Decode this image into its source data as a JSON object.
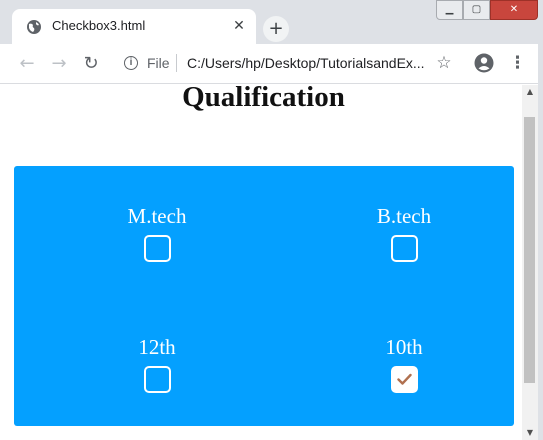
{
  "browser": {
    "tab_title": "Checkbox3.html",
    "tab_close": "✕",
    "new_tab": "+",
    "url_scheme": "File",
    "url": "C:/Users/hp/Desktop/TutorialsandEx...",
    "icons": {
      "favicon": "globe-icon",
      "back": "arrow-left-icon",
      "forward": "arrow-right-icon",
      "reload": "reload-icon",
      "info": "info-icon",
      "bookmark": "star-icon",
      "profile": "profile-icon",
      "menu": "menu-icon"
    }
  },
  "page": {
    "title": "Qualification",
    "panel_color": "#04a0ff",
    "options": [
      {
        "label": "M.tech",
        "checked": false
      },
      {
        "label": "B.tech",
        "checked": false
      },
      {
        "label": "12th",
        "checked": false
      },
      {
        "label": "10th",
        "checked": true
      }
    ],
    "check_color": "#b0704f"
  }
}
